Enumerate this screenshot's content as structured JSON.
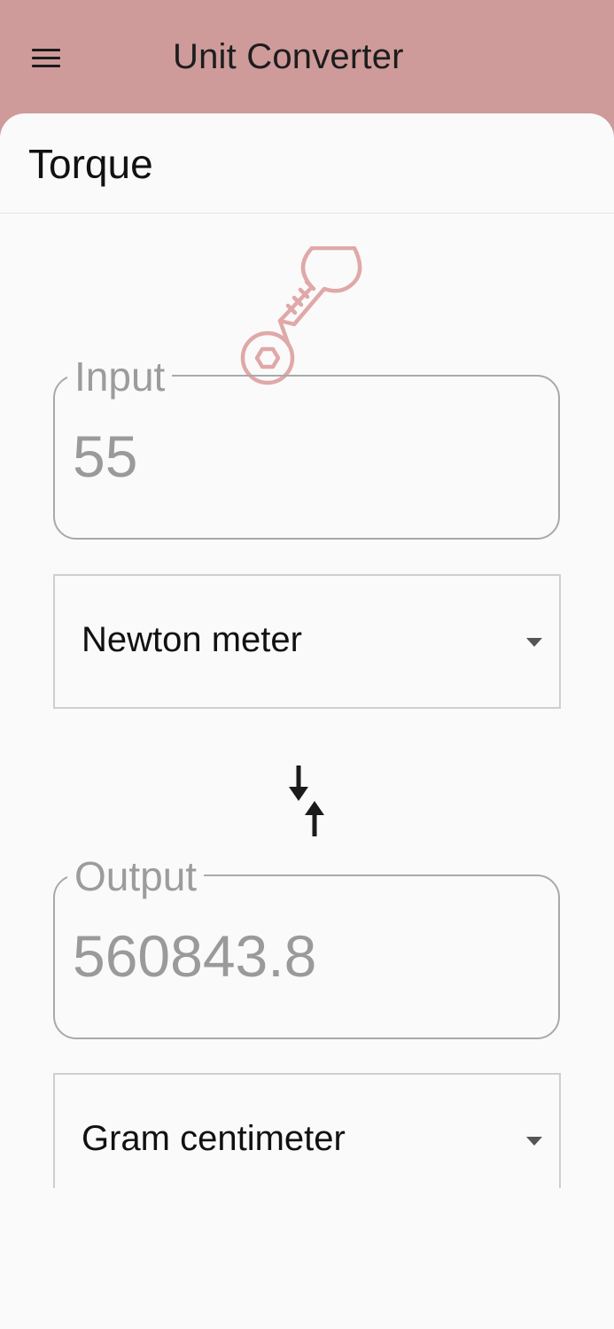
{
  "app_bar": {
    "title": "Unit Converter",
    "menu_icon": "hamburger-menu-icon"
  },
  "page": {
    "title": "Torque",
    "hero_icon": "wrench-icon",
    "accent_color": "#cf9a9a"
  },
  "input": {
    "label": "Input",
    "value": "55"
  },
  "from_unit": {
    "selected": "Newton meter"
  },
  "swap": {
    "icon": "swap-arrows-icon"
  },
  "output": {
    "label": "Output",
    "value": "560843.8"
  },
  "to_unit": {
    "selected": "Gram centimeter"
  }
}
